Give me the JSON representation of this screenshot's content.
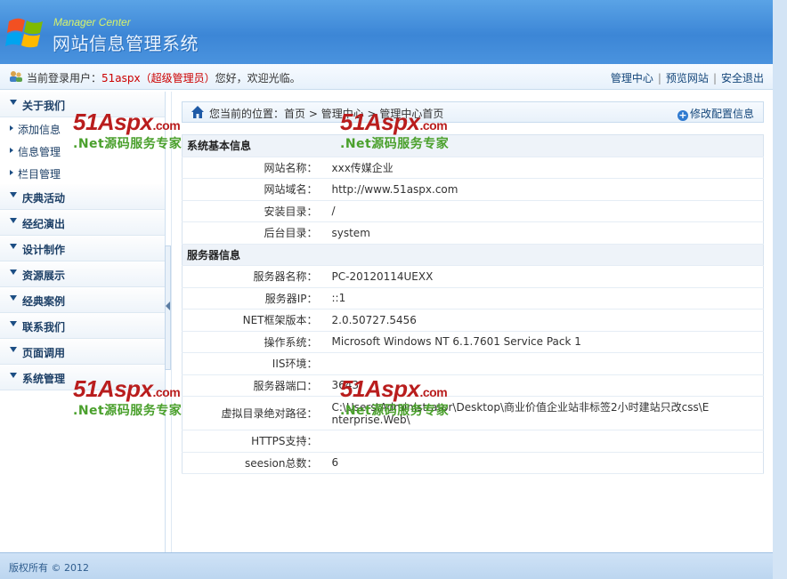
{
  "header": {
    "brand_en": "Manager Center",
    "brand_cn": "网站信息管理系统"
  },
  "userbar": {
    "prefix": "当前登录用户：",
    "username": "51aspx（超级管理员）",
    "greeting": "您好，欢迎光临。",
    "nav": [
      "管理中心",
      "预览网站",
      "安全退出"
    ]
  },
  "sidebar": {
    "groups": [
      {
        "label": "关于我们",
        "items": [
          "添加信息",
          "信息管理",
          "栏目管理"
        ]
      },
      {
        "label": "庆典活动"
      },
      {
        "label": "经纪演出"
      },
      {
        "label": "设计制作"
      },
      {
        "label": "资源展示"
      },
      {
        "label": "经典案例"
      },
      {
        "label": "联系我们"
      },
      {
        "label": "页面调用"
      },
      {
        "label": "系统管理"
      }
    ]
  },
  "breadcrumb": {
    "prefix": "您当前的位置：",
    "home": "首页",
    "sep": " > ",
    "level2": "管理中心",
    "level3": "管理中心首页",
    "modify": "修改配置信息"
  },
  "info": {
    "section1": "系统基本信息",
    "rows1": [
      {
        "k": "网站名称：",
        "v": "xxx传媒企业"
      },
      {
        "k": "网站域名：",
        "v": "http://www.51aspx.com"
      },
      {
        "k": "安装目录：",
        "v": "/"
      },
      {
        "k": "后台目录：",
        "v": "system"
      }
    ],
    "section2": "服务器信息",
    "rows2": [
      {
        "k": "服务器名称：",
        "v": "PC-20120114UEXX"
      },
      {
        "k": "服务器IP：",
        "v": "::1"
      },
      {
        "k": "NET框架版本：",
        "v": "2.0.50727.5456"
      },
      {
        "k": "操作系统：",
        "v": "Microsoft Windows NT 6.1.7601 Service Pack 1"
      },
      {
        "k": "IIS环境：",
        "v": ""
      },
      {
        "k": "服务器端口：",
        "v": "3643"
      },
      {
        "k": "虚拟目录绝对路径：",
        "v": "C:\\Users\\Administrator\\Desktop\\商业价值企业站非标签2小时建站只改css\\Enterprise.Web\\"
      },
      {
        "k": "HTTPS支持：",
        "v": ""
      },
      {
        "k": "seesion总数：",
        "v": "6"
      }
    ]
  },
  "watermark": {
    "big_num": "51",
    "big_aspx": "Aspx",
    "big_com": ".com",
    "small": ".Net源码服务专家"
  },
  "footer": {
    "text": "版权所有 © 2012"
  },
  "colors": {
    "header_blue": "#3c86d6",
    "brand_en": "#d7f36a",
    "username_red": "#cc0000",
    "link_blue": "#14467a",
    "watermark_red": "#b91d1d",
    "watermark_green": "#4aa02c"
  }
}
